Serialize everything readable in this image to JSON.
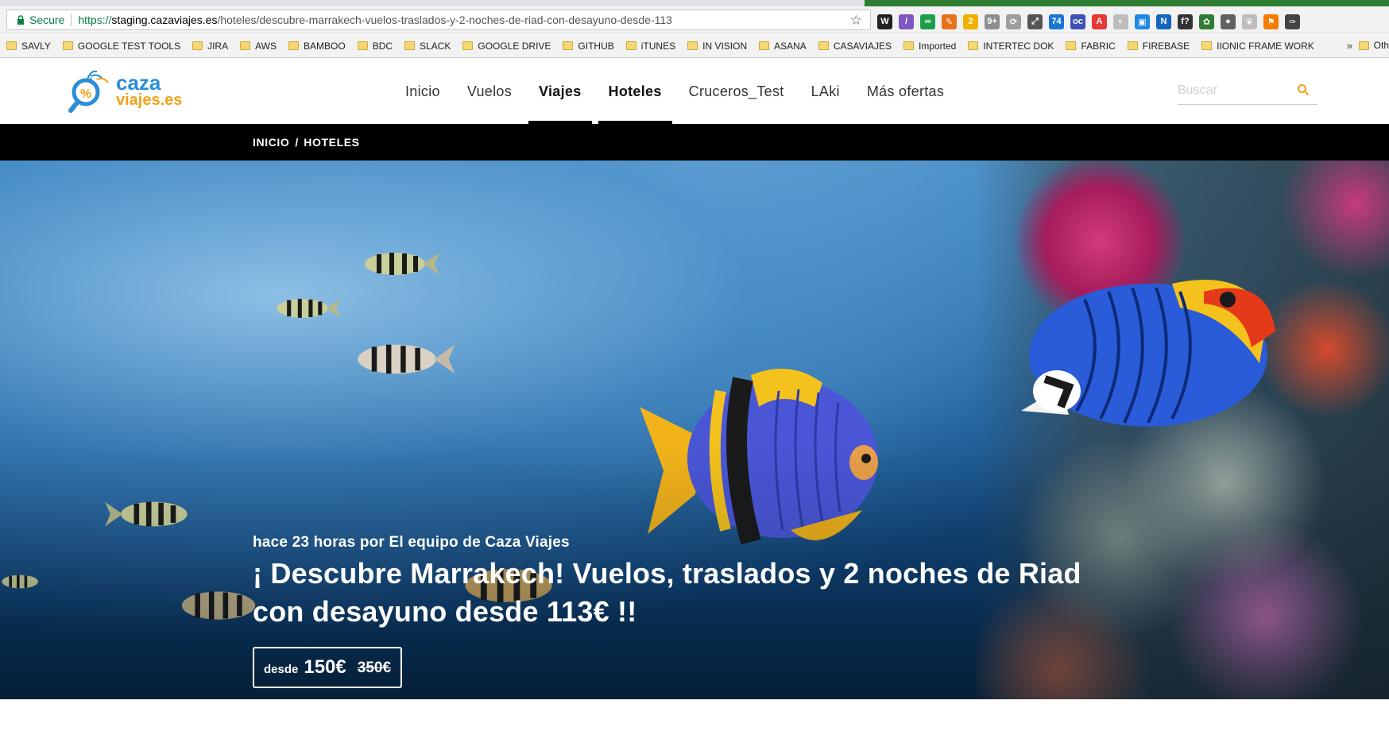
{
  "browser": {
    "secure_label": "Secure",
    "url_scheme": "https://",
    "url_host": "staging.cazaviajes.es",
    "url_path": "/hoteles/descubre-marrakech-vuelos-traslados-y-2-noches-de-riad-con-desayuno-desde-113",
    "extensions": [
      {
        "icon": "w-icon",
        "color": "#222222",
        "label": "W"
      },
      {
        "icon": "quill-icon",
        "color": "#7e57c2",
        "label": "/"
      },
      {
        "icon": "infinity-icon",
        "color": "#1e9e4a",
        "label": "∞"
      },
      {
        "icon": "pen-icon",
        "color": "#e8711a",
        "label": "✎"
      },
      {
        "icon": "bulb-icon",
        "color": "#f2b100",
        "label": "2"
      },
      {
        "icon": "gear-badge-icon",
        "color": "#8e8e8e",
        "label": "9+"
      },
      {
        "icon": "refresh-icon",
        "color": "#9e9e9e",
        "label": "⟳"
      },
      {
        "icon": "compass-icon",
        "color": "#555555",
        "label": "⤢"
      },
      {
        "icon": "calendar-icon",
        "color": "#1976d2",
        "label": "74"
      },
      {
        "icon": "grid-icon",
        "color": "#3f51b5",
        "label": "oc"
      },
      {
        "icon": "a-icon",
        "color": "#e53935",
        "label": "A"
      },
      {
        "icon": "leaf-icon",
        "color": "#bdbdbd",
        "label": "◐"
      },
      {
        "icon": "window-icon",
        "color": "#1e88e5",
        "label": "▣"
      },
      {
        "icon": "new-icon",
        "color": "#1565c0",
        "label": "N"
      },
      {
        "icon": "function-icon",
        "color": "#333333",
        "label": "f?"
      },
      {
        "icon": "puzzle-icon",
        "color": "#2e7d32",
        "label": "✿"
      },
      {
        "icon": "record-icon",
        "color": "#616161",
        "label": "●"
      },
      {
        "icon": "feather-icon",
        "color": "#bdbdbd",
        "label": "❦"
      },
      {
        "icon": "flag-icon",
        "color": "#f57c00",
        "label": "⚑"
      },
      {
        "icon": "wrench-icon",
        "color": "#444444",
        "label": "✑"
      }
    ]
  },
  "bookmarks": {
    "items": [
      "SAVLY",
      "GOOGLE TEST TOOLS",
      "JIRA",
      "AWS",
      "BAMBOO",
      "BDC",
      "SLACK",
      "GOOGLE DRIVE",
      "GITHUB",
      "iTUNES",
      "IN VISION",
      "ASANA",
      "CASAVIAJES",
      "Imported",
      "INTERTEC DOK",
      "FABRIC",
      "FIREBASE",
      "IIONIC FRAME WORK"
    ],
    "more": "»",
    "other": "Oth"
  },
  "header": {
    "logo_line1": "caza",
    "logo_line2": "viajes.es",
    "nav": [
      {
        "label": "Inicio",
        "active": false
      },
      {
        "label": "Vuelos",
        "active": false
      },
      {
        "label": "Viajes",
        "active": true
      },
      {
        "label": "Hoteles",
        "active": true
      },
      {
        "label": "Cruceros_Test",
        "active": false
      },
      {
        "label": "LAki",
        "active": false
      },
      {
        "label": "Más ofertas",
        "active": false
      }
    ],
    "search_placeholder": "Buscar",
    "accent": "#f2a21a"
  },
  "breadcrumb": {
    "home": "INICIO",
    "separator": "/",
    "current": "HOTELES"
  },
  "hero": {
    "meta": "hace 23 horas por El equipo de Caza Viajes",
    "title": "¡ Descubre Marrakech! Vuelos, traslados y 2 noches de Riad con desayuno desde 113€ !!",
    "price_from": "desde",
    "price_now": "150€",
    "price_old": "350€"
  }
}
